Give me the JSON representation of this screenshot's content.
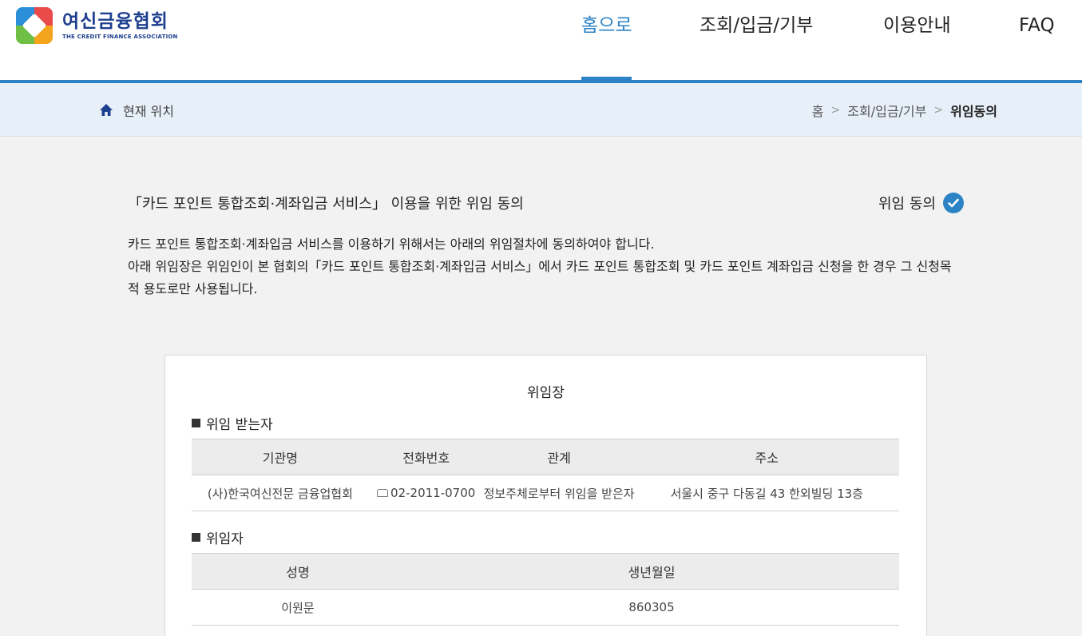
{
  "header": {
    "logo_ko": "여신금융협회",
    "logo_en": "THE CREDIT FINANCE ASSOCIATION",
    "nav": [
      {
        "label": "홈으로",
        "active": true
      },
      {
        "label": "조회/입금/기부",
        "active": false
      },
      {
        "label": "이용안내",
        "active": false
      },
      {
        "label": "FAQ",
        "active": false
      }
    ]
  },
  "location": {
    "label": "현재 위치",
    "crumbs": [
      "홈",
      "조회/입금/기부",
      "위임동의"
    ],
    "separator": ">"
  },
  "intro": {
    "title": "「카드 포인트 통합조회·계좌입금 서비스」 이용을 위한 위임 동의",
    "consent_label": "위임 동의",
    "desc_line1": "카드 포인트 통합조회·계좌입금 서비스를 이용하기 위해서는 아래의 위임절차에 동의하여야 합니다.",
    "desc_line2": "아래 위임장은 위임인이 본 협회의「카드 포인트 통합조회·계좌입금 서비스」에서 카드 포인트 통합조회 및 카드 포인트 계좌입금 신청을 한 경우 그 신청목적 용도로만 사용됩니다."
  },
  "document": {
    "title": "위임장",
    "recipient": {
      "title": "위임 받는자",
      "headers": [
        "기관명",
        "전화번호",
        "관계",
        "주소"
      ],
      "row": [
        "(사)한국여신전문 금융업협회",
        "02-2011-0700",
        "정보주체로부터 위임을 받은자",
        "서울시 중구 다동길 43 한외빌딩 13층"
      ]
    },
    "delegator": {
      "title": "위임자",
      "headers": [
        "성명",
        "생년월일"
      ],
      "row": [
        "이원문",
        "860305"
      ]
    }
  },
  "colors": {
    "accent": "#2b83c5",
    "location_bg": "#e7eff8",
    "page_bg": "#f2f2f2"
  }
}
